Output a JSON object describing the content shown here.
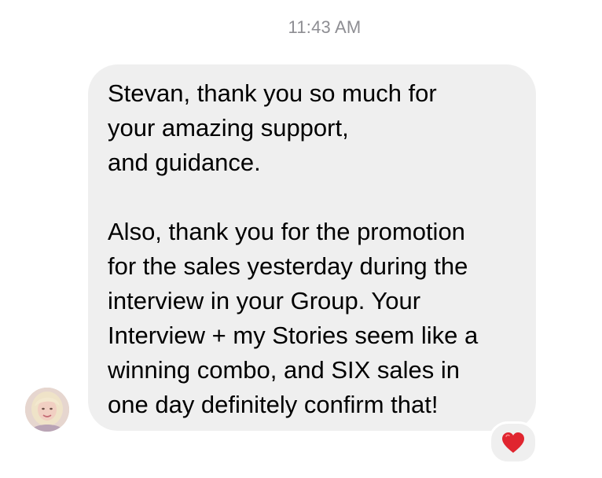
{
  "thread": {
    "timestamp": "11:43 AM"
  },
  "message": {
    "lines": [
      "Stevan, thank you so much for",
      "your amazing support,",
      "and guidance.",
      "",
      "Also, thank you for the promotion",
      "for the sales yesterday during the",
      "interview in your Group. Your",
      "Interview + my Stories seem like a",
      "winning combo, and SIX sales in",
      "one day definitely confirm that!"
    ],
    "reaction_icon": "heart-icon",
    "reaction_color": "#e0252f",
    "bubble_color": "#efefef"
  },
  "sender": {
    "avatar_icon": "avatar"
  }
}
